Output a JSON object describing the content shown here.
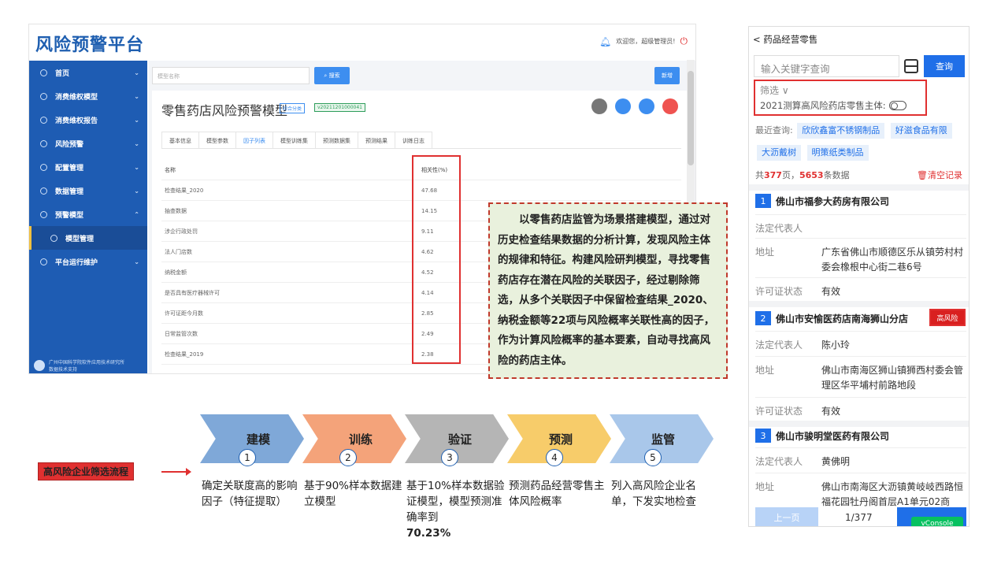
{
  "app": {
    "logo": "风险预警平台",
    "greeting": "欢迎您，超级管理员!",
    "sidebar": [
      {
        "label": "首页"
      },
      {
        "label": "消费维权模型"
      },
      {
        "label": "消费维权报告"
      },
      {
        "label": "风险预警"
      },
      {
        "label": "配置管理"
      },
      {
        "label": "数据管理"
      },
      {
        "label": "预警模型"
      },
      {
        "label": "模型管理"
      },
      {
        "label": "平台运行维护"
      }
    ],
    "sidebar_footer": "广州中国科学院软件应用技术研究所\n数据技术支持",
    "search_placeholder": "模型名称",
    "search_btn": "搜索",
    "add_btn": "新增",
    "model_title": "零售药店风险预警模型",
    "tag1": "综合分类",
    "tag2": "v20211201000041",
    "tabs": [
      "基本信息",
      "模型参数",
      "因子列表",
      "模型训练集",
      "预测数据集",
      "预测结果",
      "训练日志"
    ],
    "table_headers": [
      "名称",
      "相关性(%)"
    ],
    "table_rows": [
      [
        "检查结果_2020",
        "47.68"
      ],
      [
        "抽查数据",
        "14.15"
      ],
      [
        "涉企行政处罚",
        "9.11"
      ],
      [
        "法人门店数",
        "4.62"
      ],
      [
        "纳税金额",
        "4.52"
      ],
      [
        "是否具有医疗器械许可",
        "4.14"
      ],
      [
        "许可证距今月数",
        "2.85"
      ],
      [
        "日常监管次数",
        "2.49"
      ],
      [
        "检查结果_2019",
        "2.38"
      ]
    ]
  },
  "note": "以零售药店监管为场景搭建模型，通过对历史检查结果数据的分析计算，发现风险主体的规律和特征。构建风险研判模型，寻找零售药店存在潜在风险的关联因子，经过剔除筛选，从多个关联因子中保留检查结果_2020、纳税金额等22项与风险概率关联性高的因子，作为计算风险概率的基本要素，自动寻找高风险的药店主体。",
  "flow": {
    "label": "高风险企业筛选流程",
    "steps": [
      {
        "title": "建模",
        "num": "1",
        "desc": "确定关联度高的影响因子（特征提取）",
        "color": "#7fa8d8"
      },
      {
        "title": "训练",
        "num": "2",
        "desc": "基于90%样本数据建立模型",
        "color": "#f4a37a"
      },
      {
        "title": "验证",
        "num": "3",
        "desc": "基于10%样本数据验证模型，模型预测准确率到",
        "desc_bold": "70.23%",
        "color": "#b5b5b5"
      },
      {
        "title": "预测",
        "num": "4",
        "desc": "预测药品经营零售主体风险概率",
        "color": "#f7cc6a"
      },
      {
        "title": "监管",
        "num": "5",
        "desc": "列入高风险企业名单，下发实地检查",
        "color": "#a9c7ea"
      }
    ]
  },
  "mobile": {
    "header": "< 药品经营零售",
    "search_placeholder": "输入关键字查询",
    "query_btn": "查询",
    "filter": "筛选 ∨",
    "filter_sub": "2021测算高风险药店零售主体:",
    "recent_label": "最近查询:",
    "recent_chips": [
      "欣欣鑫富不锈钢制品",
      "好滋食品有限",
      "大沥戴树",
      "明策纸类制品"
    ],
    "count_prefix": "共",
    "pages": "377",
    "count_mid": "页，",
    "records": "5653",
    "count_suffix": "条数据",
    "clear": "清空记录",
    "items": [
      {
        "num": "1",
        "name": "佛山市福参大药房有限公司",
        "rep_label": "法定代表人",
        "rep": "",
        "addr_label": "地址",
        "addr": "广东省佛山市顺德区乐从镇劳村村委会橡根中心街二巷6号",
        "lic_label": "许可证状态",
        "lic": "有效"
      },
      {
        "num": "2",
        "name": "佛山市安愉医药店南海狮山分店",
        "risk": "高风险",
        "rep_label": "法定代表人",
        "rep": "陈小玲",
        "addr_label": "地址",
        "addr": "佛山市南海区狮山镇狮西村委会管理区华平埔村前路地段",
        "lic_label": "许可证状态",
        "lic": "有效"
      },
      {
        "num": "3",
        "name": "佛山市骏明堂医药有限公司",
        "rep_label": "法定代表人",
        "rep": "黄佛明",
        "addr_label": "地址",
        "addr": "佛山市南海区大沥镇黄岐岐西路恒福花园牡丹阁首层A1单元02商"
      }
    ],
    "prev": "上一页",
    "page": "1/377",
    "vconsole": "vConsole"
  }
}
